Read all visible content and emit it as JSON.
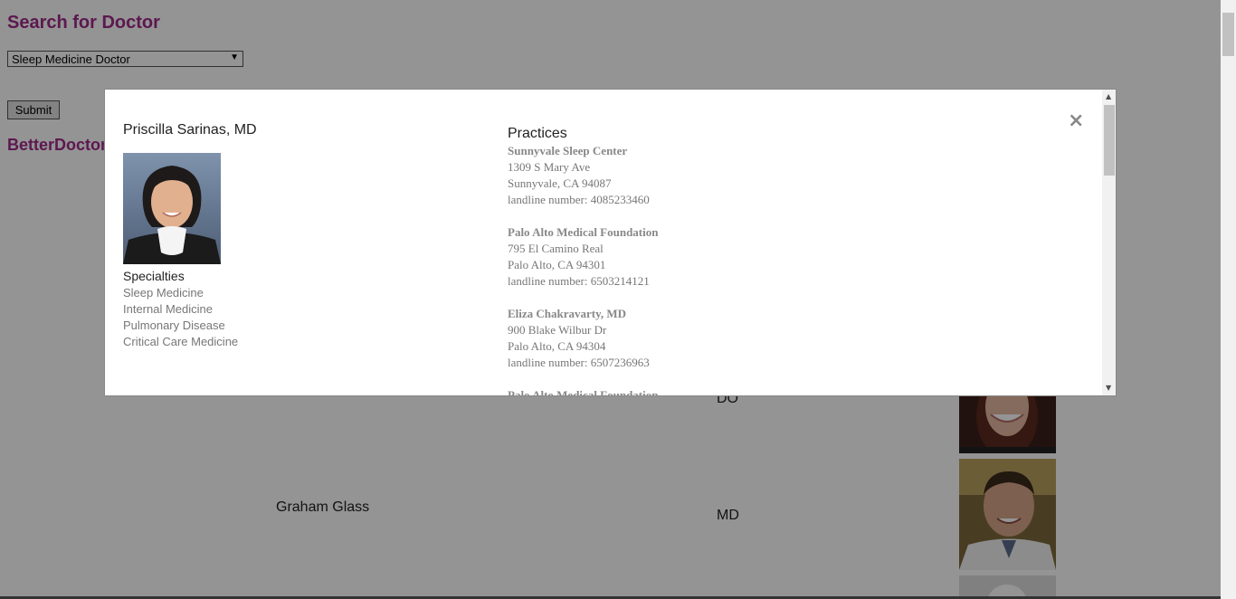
{
  "page": {
    "title": "Search for Doctor",
    "specialty_select": {
      "value": "Sleep Medicine Doctor"
    },
    "submit_label": "Submit",
    "subtitle": "BetterDoctor",
    "rows": [
      {
        "name": "",
        "credential": "DO"
      },
      {
        "name": "Graham Glass",
        "credential": "MD"
      }
    ]
  },
  "modal": {
    "close_label": "×",
    "doctor_name": "Priscilla Sarinas, MD",
    "specialties_heading": "Specialties",
    "specialties": [
      "Sleep Medicine",
      "Internal Medicine",
      "Pulmonary Disease",
      "Critical Care Medicine"
    ],
    "practices_heading": "Practices",
    "practices": [
      {
        "name": "Sunnyvale Sleep Center",
        "street": "1309 S Mary Ave",
        "city": "Sunnyvale, CA 94087",
        "phone": "landline number: 4085233460"
      },
      {
        "name": "Palo Alto Medical Foundation",
        "street": "795 El Camino Real",
        "city": "Palo Alto, CA 94301",
        "phone": "landline number: 6503214121"
      },
      {
        "name": "Eliza Chakravarty, MD",
        "street": "900 Blake Wilbur Dr",
        "city": "Palo Alto, CA 94304",
        "phone": "landline number: 6507236963"
      },
      {
        "name": "Palo Alto Medical Foundation",
        "street": "",
        "city": "",
        "phone": ""
      }
    ]
  },
  "colors": {
    "heading": "#a02a8a",
    "overlay": "rgba(0,0,0,0.42)"
  },
  "icons": {
    "close": "close-icon",
    "scroll_up": "scroll-up-icon",
    "scroll_down": "scroll-down-icon"
  }
}
